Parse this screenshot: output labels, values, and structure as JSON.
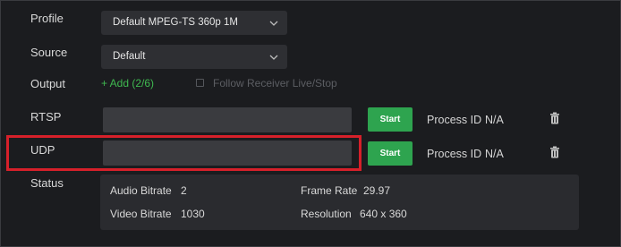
{
  "labels": {
    "profile": "Profile",
    "source": "Source",
    "output": "Output",
    "rtsp": "RTSP",
    "udp": "UDP",
    "status": "Status"
  },
  "profile_select": {
    "value": "Default MPEG-TS 360p 1M"
  },
  "source_select": {
    "value": "Default"
  },
  "output": {
    "add_label": "+ Add (2/6)",
    "follow_receiver_label": "Follow Receiver Live/Stop",
    "follow_receiver_checked": false
  },
  "rtsp": {
    "url_value": "",
    "start_label": "Start",
    "process_id_label": "Process ID",
    "process_id_value": "N/A"
  },
  "udp": {
    "url_value": "",
    "start_label": "Start",
    "process_id_label": "Process ID",
    "process_id_value": "N/A"
  },
  "status": {
    "audio_bitrate_label": "Audio Bitrate",
    "audio_bitrate_value": "2",
    "video_bitrate_label": "Video Bitrate",
    "video_bitrate_value": "1030",
    "frame_rate_label": "Frame Rate",
    "frame_rate_value": "29.97",
    "resolution_label": "Resolution",
    "resolution_value": "640 x 360"
  },
  "icons": {
    "dropdown": "chevron-down-icon",
    "delete": "trash-icon"
  },
  "colors": {
    "background": "#1b1c1f",
    "accent_green": "#2ea44f",
    "link_green": "#3fb950",
    "highlight_red": "#d6202a"
  }
}
